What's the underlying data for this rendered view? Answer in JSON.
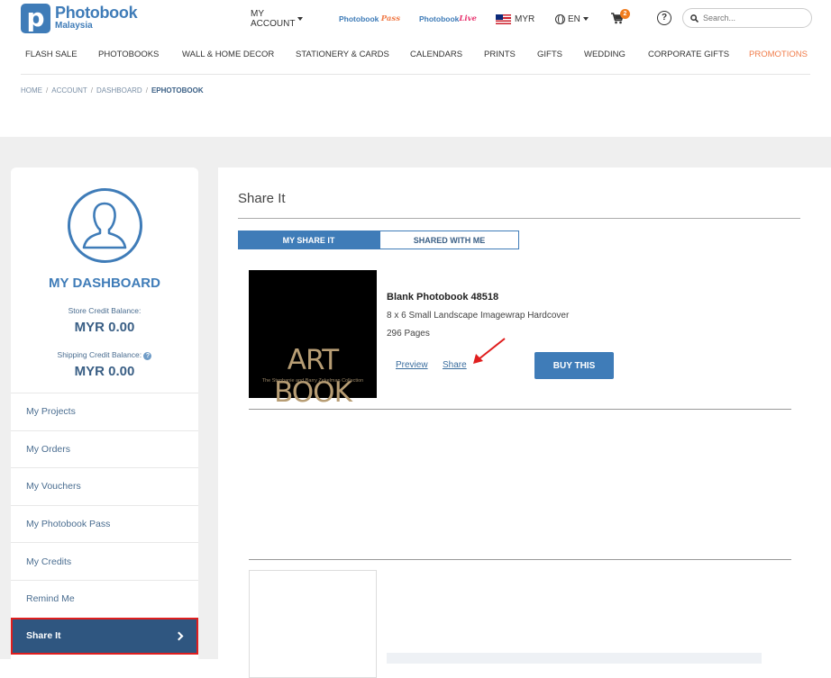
{
  "header": {
    "logo": {
      "name": "Photobook",
      "sub": "Malaysia",
      "mark": "p"
    },
    "topbar": {
      "account": "MY ACCOUNT",
      "pass_brand": "Photobook",
      "pass_word": "Pass",
      "live_brand": "Photobook",
      "live_word": "Live",
      "currency": "MYR",
      "language": "EN",
      "cart_count": "2",
      "help": "?"
    },
    "search": {
      "placeholder": "Search..."
    },
    "nav": [
      "FLASH SALE",
      "PHOTOBOOKS",
      "WALL & HOME DECOR",
      "STATIONERY & CARDS",
      "CALENDARS",
      "PRINTS",
      "GIFTS",
      "WEDDING",
      "CORPORATE GIFTS",
      "PROMOTIONS"
    ],
    "breadcrumb": [
      "HOME",
      "ACCOUNT",
      "DASHBOARD",
      "EPHOTOBOOK"
    ]
  },
  "sidebar": {
    "title": "MY DASHBOARD",
    "store_credit_label": "Store Credit Balance:",
    "store_credit_value": "MYR 0.00",
    "shipping_credit_label": "Shipping Credit Balance:",
    "shipping_credit_value": "MYR 0.00",
    "menu": [
      "My Projects",
      "My Orders",
      "My Vouchers",
      "My Photobook Pass",
      "My Credits",
      "Remind Me",
      "Share It"
    ],
    "active_item": "Share It"
  },
  "main": {
    "title": "Share It",
    "tabs": [
      "MY SHARE IT",
      "SHARED WITH ME"
    ],
    "active_tab": "MY SHARE IT",
    "item": {
      "thumb_title": "ART BOOK",
      "thumb_subtitle": "The Stephanie and Barry Zekelman Collection",
      "name": "Blank Photobook 48518",
      "description": "8 x 6 Small Landscape Imagewrap Hardcover",
      "pages": "296 Pages",
      "preview_label": "Preview",
      "share_label": "Share",
      "buy_label": "BUY THIS"
    }
  },
  "colors": {
    "brand": "#3f7cb8",
    "active_menu": "#2f5680",
    "promo": "#f07c4a",
    "highlight": "#e01e1e"
  }
}
